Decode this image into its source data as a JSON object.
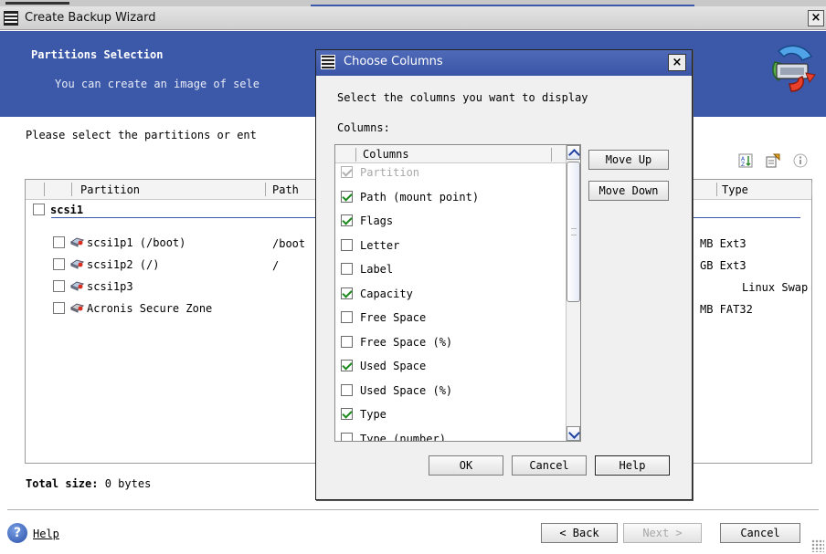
{
  "window": {
    "title": "Create Backup Wizard",
    "close_glyph": "×"
  },
  "banner": {
    "heading": "Partitions Selection",
    "subheading": "You can create an image of sele"
  },
  "instruction": "Please select the partitions or ent",
  "grid": {
    "columns": {
      "partition": "Partition",
      "path": "Path",
      "type": "Type"
    },
    "group": "scsi1",
    "rows": [
      {
        "name": "scsi1p1 (/boot)",
        "path": "/boot",
        "type": "MB Ext3"
      },
      {
        "name": "scsi1p2 (/)",
        "path": "/",
        "type": "GB Ext3"
      },
      {
        "name": "scsi1p3",
        "path": "",
        "type": "Linux Swap"
      },
      {
        "name": "Acronis Secure Zone",
        "path": "",
        "type": "MB FAT32"
      }
    ]
  },
  "footer": {
    "total_label": "Total size:",
    "total_value": "0 bytes",
    "help": "Help",
    "back": "< Back",
    "next": "Next >",
    "cancel": "Cancel"
  },
  "dialog": {
    "title": "Choose Columns",
    "close_glyph": "×",
    "prompt": "Select the columns you want to display",
    "columns_label": "Columns:",
    "list_header": "Columns",
    "items": [
      {
        "label": "Partition",
        "checked": true,
        "disabled": true
      },
      {
        "label": "Path (mount point)",
        "checked": true
      },
      {
        "label": "Flags",
        "checked": true
      },
      {
        "label": "Letter",
        "checked": false
      },
      {
        "label": "Label",
        "checked": false
      },
      {
        "label": "Capacity",
        "checked": true
      },
      {
        "label": "Free Space",
        "checked": false
      },
      {
        "label": "Free Space (%)",
        "checked": false
      },
      {
        "label": "Used Space",
        "checked": true
      },
      {
        "label": "Used Space (%)",
        "checked": false
      },
      {
        "label": "Type",
        "checked": true
      },
      {
        "label": "Type (number)",
        "checked": false
      }
    ],
    "move_up": "Move Up",
    "move_down": "Move Down",
    "ok": "OK",
    "cancel": "Cancel",
    "help": "Help"
  },
  "icons": {
    "help": "help-circle-icon",
    "disk": "hard-disk-icon",
    "logo": "acronis-backup-icon"
  },
  "colors": {
    "banner": "#3c58a8",
    "dialog_title": "#3a55a6",
    "check": "#1a8a1a"
  }
}
